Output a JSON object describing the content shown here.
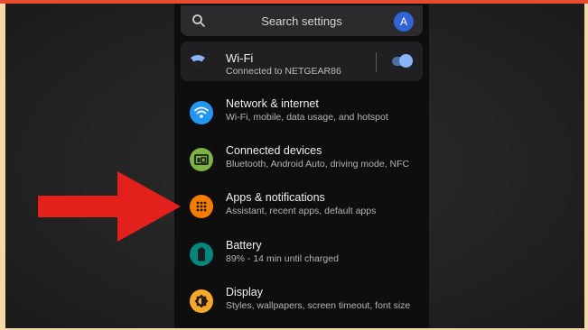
{
  "search": {
    "placeholder": "Search settings",
    "avatar_letter": "A"
  },
  "wifi": {
    "title": "Wi-Fi",
    "status": "Connected to NETGEAR86",
    "enabled": true
  },
  "items": [
    {
      "title": "Network & internet",
      "subtitle": "Wi-Fi, mobile, data usage, and hotspot",
      "icon": "wifi-icon",
      "color": "#2196f3"
    },
    {
      "title": "Connected devices",
      "subtitle": "Bluetooth, Android Auto, driving mode, NFC",
      "icon": "devices-icon",
      "color": "#7cb342"
    },
    {
      "title": "Apps & notifications",
      "subtitle": "Assistant, recent apps, default apps",
      "icon": "apps-grid-icon",
      "color": "#f57c00"
    },
    {
      "title": "Battery",
      "subtitle": "89% - 14 min until charged",
      "icon": "battery-icon",
      "color": "#00897b"
    },
    {
      "title": "Display",
      "subtitle": "Styles, wallpapers, screen timeout, font size",
      "icon": "brightness-icon",
      "color": "#f9a825"
    }
  ],
  "annotation": {
    "icon": "red-arrow-icon",
    "color": "#e3201b"
  }
}
